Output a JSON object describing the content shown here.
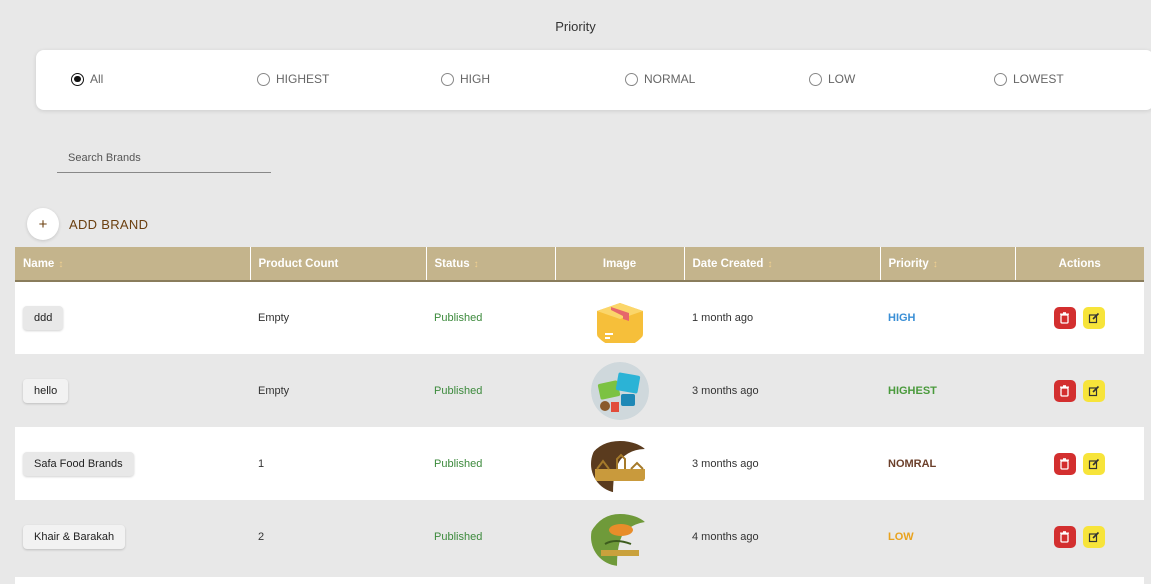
{
  "filters": {
    "title": "Priority",
    "options": [
      {
        "label": "All",
        "checked": true
      },
      {
        "label": "HIGHEST",
        "checked": false
      },
      {
        "label": "HIGH",
        "checked": false
      },
      {
        "label": "NORMAL",
        "checked": false
      },
      {
        "label": "LOW",
        "checked": false
      },
      {
        "label": "LOWEST",
        "checked": false
      }
    ]
  },
  "search": {
    "placeholder": "Search Brands",
    "value": ""
  },
  "add_brand": {
    "icon": "+",
    "label": "ADD BRAND"
  },
  "table": {
    "headers": {
      "name": "Name",
      "product_count": "Product Count",
      "status": "Status",
      "image": "Image",
      "date_created": "Date Created",
      "priority": "Priority",
      "actions": "Actions"
    },
    "rows": [
      {
        "name": "ddd",
        "product_count": "Empty",
        "status": "Published",
        "image": "box-icon",
        "date_created": "1 month ago",
        "priority": "HIGH",
        "priority_color": "#3a8fd6"
      },
      {
        "name": "hello",
        "product_count": "Empty",
        "status": "Published",
        "image": "brand-banner-image",
        "date_created": "3 months ago",
        "priority": "HIGHEST",
        "priority_color": "#4a9a3c"
      },
      {
        "name": "Safa Food Brands",
        "product_count": "1",
        "status": "Published",
        "image": "safa-logo-image",
        "date_created": "3 months ago",
        "priority": "NOMRAL",
        "priority_color": "#6b3f2a"
      },
      {
        "name": "Khair & Barakah",
        "product_count": "2",
        "status": "Published",
        "image": "khair-barakah-logo-image",
        "date_created": "4 months ago",
        "priority": "LOW",
        "priority_color": "#e8a21e"
      }
    ]
  },
  "colors": {
    "header_bg": "#c4b48c",
    "accent_brown": "#6b3f0f",
    "status_green": "#3c8a3c",
    "delete_red": "#d32f2f",
    "edit_yellow": "#f7e43a"
  }
}
